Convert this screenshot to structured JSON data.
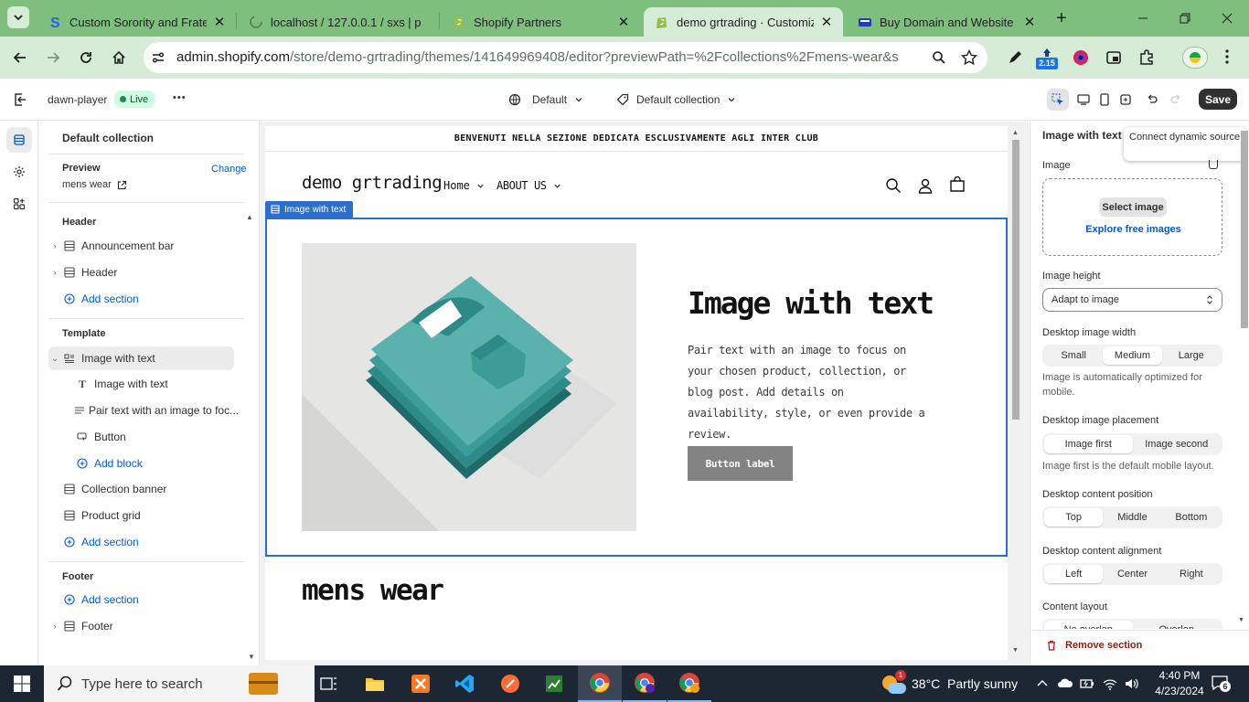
{
  "browser": {
    "tabs": [
      {
        "title": "Custom Sorority and Fraternity",
        "icon": "s-logo-icon"
      },
      {
        "title": "localhost / 127.0.0.1 / sxs | p",
        "icon": "loading-icon"
      },
      {
        "title": "Shopify Partners",
        "icon": "shopify-icon"
      },
      {
        "title": "demo grtrading · Customize",
        "icon": "shopify-icon"
      },
      {
        "title": "Buy Domain and Website H",
        "icon": "domain-icon"
      }
    ],
    "url_domain": "admin.shopify.com",
    "url_path": "/store/demo-grtrading/themes/141649969408/editor?previewPath=%2Fcollections%2Fmens-wear&section=te...",
    "extension_badge": "2.15",
    "colors": {
      "tabstrip": "#7ebf7e",
      "toolbar": "#d7ecd7"
    }
  },
  "editor": {
    "theme_name": "dawn-player",
    "live_badge": "Live",
    "more_label": "•••",
    "theme_setting": "Default",
    "template_setting": "Default collection",
    "save_label": "Save"
  },
  "sidebar": {
    "title": "Default collection",
    "preview_label": "Preview",
    "change_label": "Change",
    "preview_value": "mens wear",
    "header_group": "Header",
    "header_items": [
      "Announcement bar",
      "Header"
    ],
    "add_section": "Add section",
    "template_group": "Template",
    "template_section": "Image with text",
    "blocks": [
      "Image with text",
      "Pair text with an image to foc...",
      "Button"
    ],
    "add_block": "Add block",
    "template_items": [
      "Collection banner",
      "Product grid"
    ],
    "footer_group": "Footer",
    "footer_item": "Footer"
  },
  "preview": {
    "announcement": "BENVENUTI NELLA SEZIONE DEDICATA ESCLUSIVAMENTE AGLI INTER CLUB",
    "store_name": "demo grtrading",
    "nav": [
      "Home",
      "ABOUT US"
    ],
    "section_tag": "Image with text",
    "heading": "Image with text",
    "body": "Pair text with an image to focus on your chosen product, collection, or blog post. Add details on availability, style, or even provide a review.",
    "button_label": "Button label",
    "collection_title": "mens wear"
  },
  "panel": {
    "title": "Image with text",
    "tooltip": "Connect dynamic source",
    "image_label": "Image",
    "select_image": "Select image",
    "explore_images": "Explore free images",
    "height_label": "Image height",
    "height_value": "Adapt to image",
    "width_label": "Desktop image width",
    "width_options": [
      "Small",
      "Medium",
      "Large"
    ],
    "width_help": "Image is automatically optimized for mobile.",
    "placement_label": "Desktop image placement",
    "placement_options": [
      "Image first",
      "Image second"
    ],
    "placement_help": "Image first is the default mobile layout.",
    "position_label": "Desktop content position",
    "position_options": [
      "Top",
      "Middle",
      "Bottom"
    ],
    "alignment_label": "Desktop content alignment",
    "alignment_options": [
      "Left",
      "Center",
      "Right"
    ],
    "layout_label": "Content layout",
    "layout_options": [
      "No overlap",
      "Overlap"
    ],
    "remove_section": "Remove section"
  },
  "taskbar": {
    "search_placeholder": "Type here to search",
    "weather": "38°C  Partly sunny",
    "weather_badge": "1",
    "time": "4:40 PM",
    "date": "4/23/2024",
    "notification_count": "6"
  }
}
